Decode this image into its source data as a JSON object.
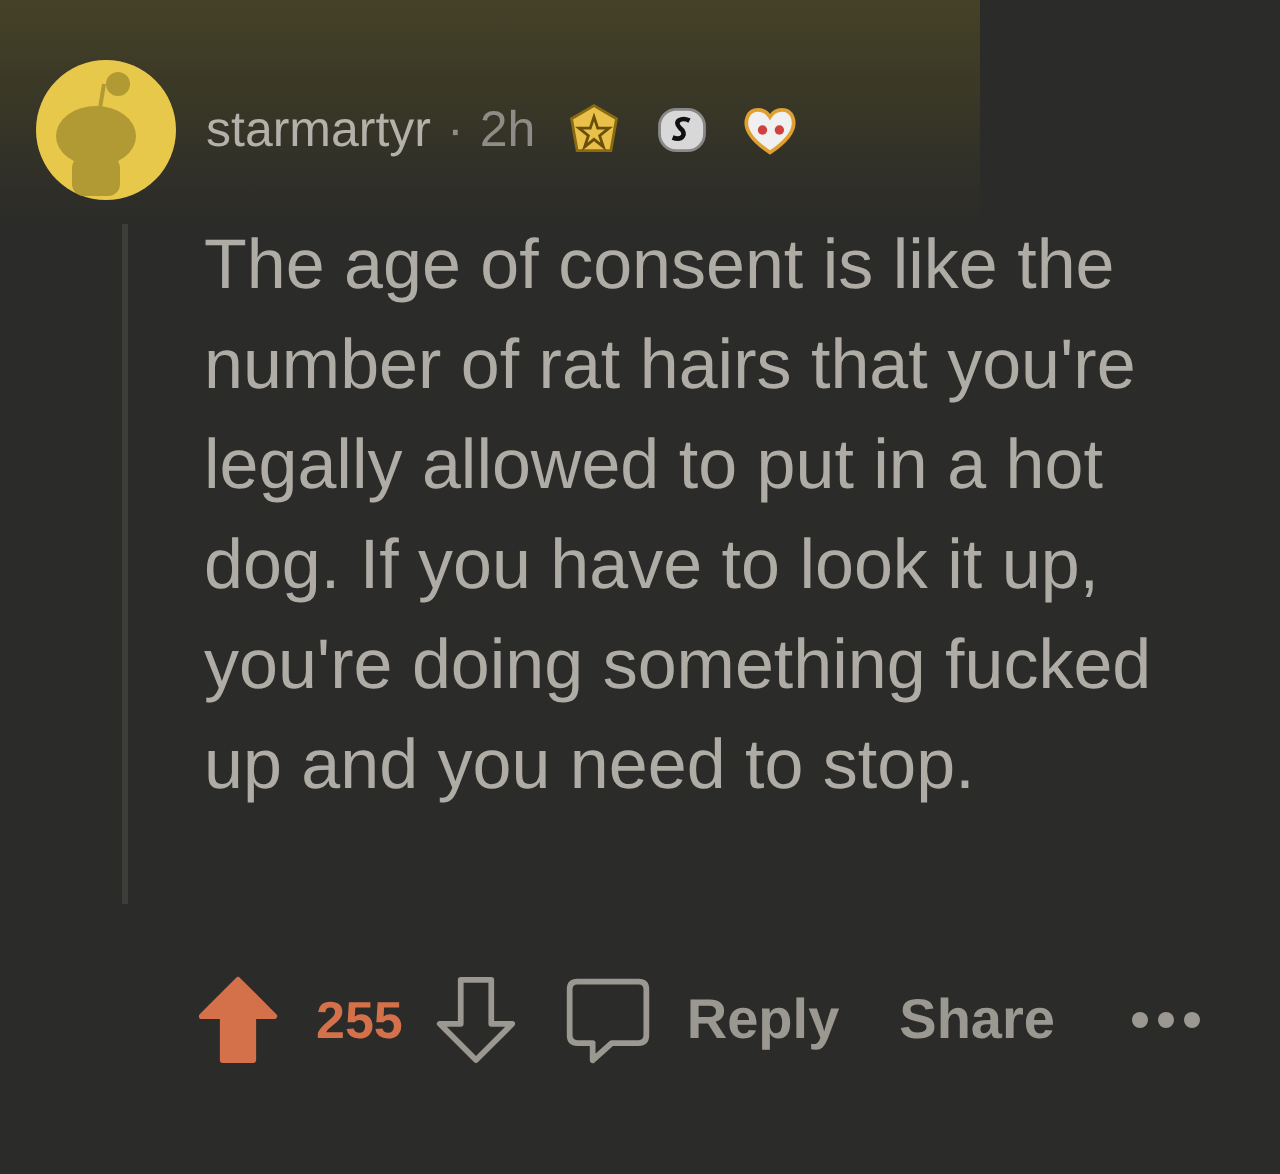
{
  "comment": {
    "author": "starmartyr",
    "separator": "·",
    "time": "2h",
    "body": "The age of consent is like the number of rat hairs that you're legally allowed to put in a hot dog. If you have to look it up, you're doing something fucked up and you need to stop.",
    "upvoted": true,
    "score": "255",
    "actions": [
      {
        "kind": "reply",
        "label": "Reply"
      },
      {
        "kind": "share",
        "label": "Share"
      }
    ]
  }
}
